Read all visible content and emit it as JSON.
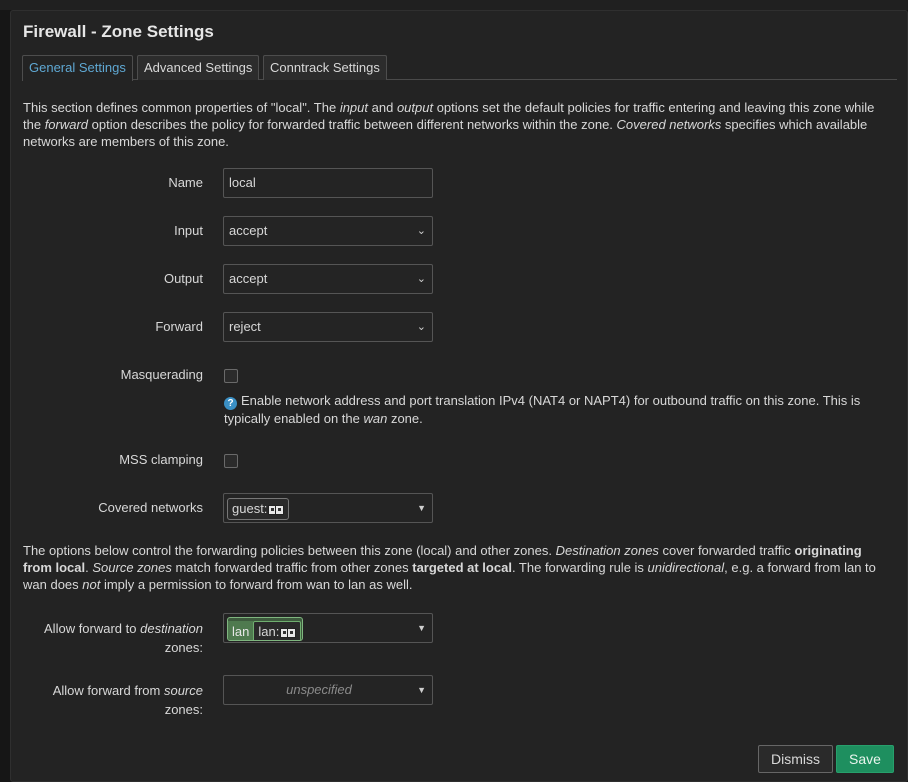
{
  "dialog": {
    "title": "Firewall - Zone Settings"
  },
  "tabs": [
    {
      "label": "General Settings"
    },
    {
      "label": "Advanced Settings"
    },
    {
      "label": "Conntrack Settings"
    }
  ],
  "intro": {
    "t1": "This section defines common properties of \"local\". The ",
    "i1": "input",
    "t2": " and ",
    "i2": "output",
    "t3": " options set the default policies for traffic entering and leaving this zone while the ",
    "i3": "forward",
    "t4": " option describes the policy for forwarded traffic between different networks within the zone. ",
    "i4": "Covered networks",
    "t5": " specifies which available networks are members of this zone."
  },
  "form": {
    "name_label": "Name",
    "name_value": "local",
    "input_label": "Input",
    "input_value": "accept",
    "output_label": "Output",
    "output_value": "accept",
    "forward_label": "Forward",
    "forward_value": "reject",
    "masq_label": "Masquerading",
    "masq_help_1": "Enable network address and port translation IPv4 (NAT4 or NAPT4) for outbound traffic on this zone. This is typically enabled on the ",
    "masq_help_wan": "wan",
    "masq_help_2": " zone.",
    "mss_label": "MSS clamping",
    "covered_label": "Covered networks",
    "covered_chip": "guest:"
  },
  "forwarding_intro": {
    "t1": "The options below control the forwarding policies between this zone (local) and other zones. ",
    "i1": "Destination zones",
    "t2": " cover forwarded traffic ",
    "b1": "originating from local",
    "t3": ". ",
    "i2": "Source zones",
    "t4": " match forwarded traffic from other zones ",
    "b2": "targeted at local",
    "t5": ". The forwarding rule is ",
    "i3": "unidirectional",
    "t6": ", e.g. a forward from lan to wan does ",
    "i4": "not",
    "t7": " imply a permission to forward from wan to lan as well."
  },
  "forwarding": {
    "dest_label_1": "Allow forward to ",
    "dest_label_i": "destination",
    "dest_label_2": "zones:",
    "dest_zone": "lan",
    "dest_nets": "lan:",
    "src_label_1": "Allow forward from ",
    "src_label_i": "source",
    "src_label_2": "zones:",
    "src_placeholder": "unspecified"
  },
  "buttons": {
    "dismiss": "Dismiss",
    "save": "Save"
  },
  "colors": {
    "accent": "#5fa8d3",
    "save": "#1e8f5f",
    "zone_lan": "#4f7a4f"
  }
}
